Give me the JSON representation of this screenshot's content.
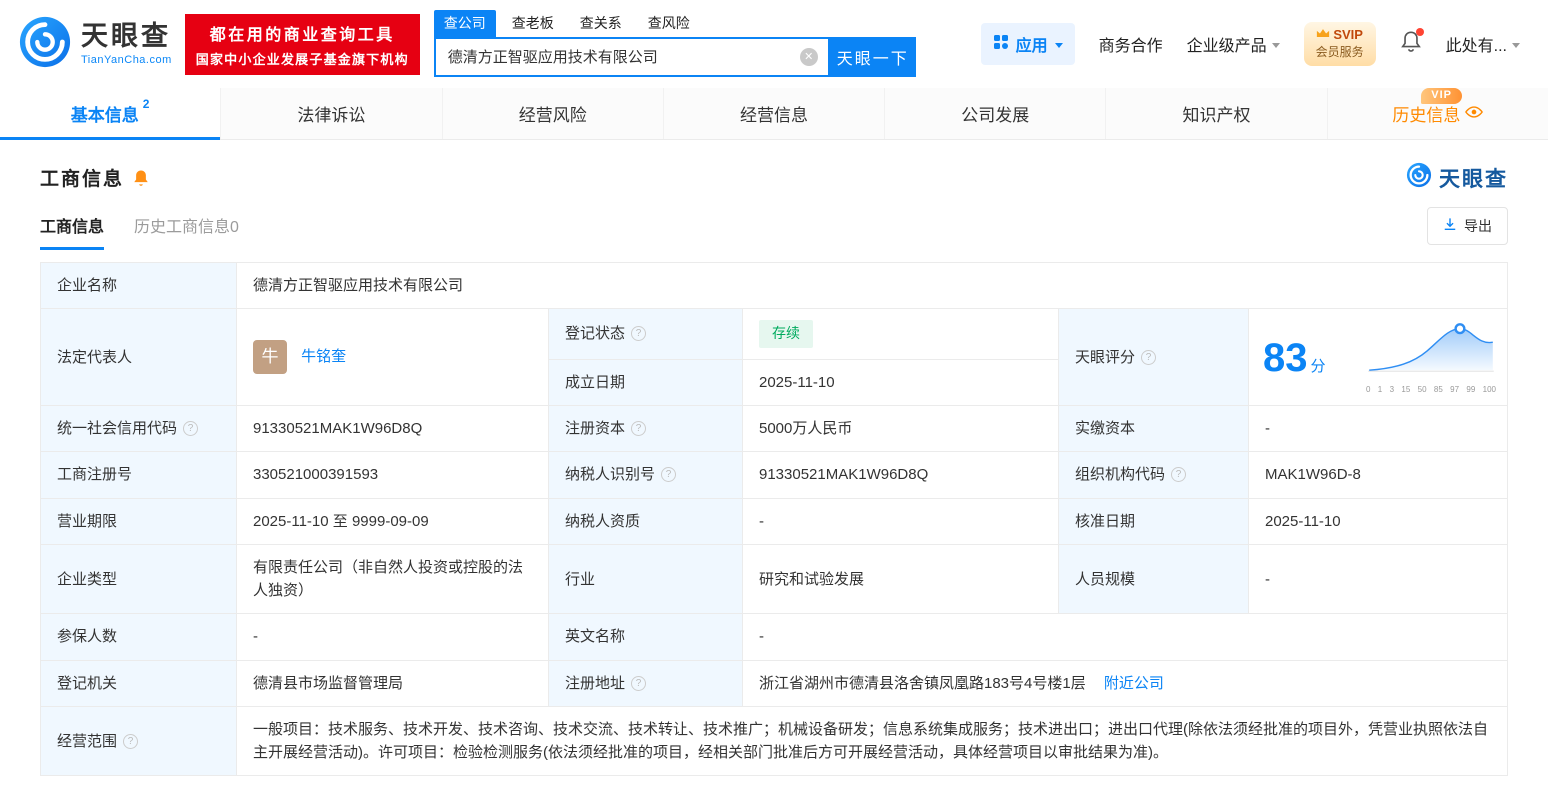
{
  "colors": {
    "accent_blue": "#0b84f5",
    "brand_red": "#e60012",
    "vip_orange": "#ff8a00",
    "status_green": "#00ab5e"
  },
  "header": {
    "logo": {
      "name_cn": "天眼查",
      "name_en": "TianYanCha.com"
    },
    "slogan_line1": "都在用的商业查询工具",
    "slogan_line2": "国家中小企业发展子基金旗下机构",
    "search_tabs": [
      {
        "label": "查公司"
      },
      {
        "label": "查老板"
      },
      {
        "label": "查关系"
      },
      {
        "label": "查风险"
      }
    ],
    "search_value": "德清方正智驱应用技术有限公司",
    "search_button": "天眼一下",
    "apps_label": "应用",
    "biz_coop": "商务合作",
    "enterprise_product": "企业级产品",
    "svip_line1": "SVIP",
    "svip_line2": "会员服务",
    "user_label": "此处有..."
  },
  "nav": {
    "tabs": [
      {
        "label": "基本信息",
        "badge": "2"
      },
      {
        "label": "法律诉讼"
      },
      {
        "label": "经营风险"
      },
      {
        "label": "经营信息"
      },
      {
        "label": "公司发展"
      },
      {
        "label": "知识产权"
      },
      {
        "label": "历史信息"
      }
    ],
    "vip_tag": "VIP"
  },
  "section": {
    "title": "工商信息",
    "watermark": "天眼查",
    "sub_tabs": [
      {
        "label": "工商信息"
      },
      {
        "label": "历史工商信息0"
      }
    ],
    "export_label": "导出"
  },
  "info": {
    "company_name": {
      "label": "企业名称",
      "value": "德清方正智驱应用技术有限公司"
    },
    "legal_rep": {
      "label": "法定代表人",
      "value": "牛铭奎",
      "avatar": "牛"
    },
    "reg_status": {
      "label": "登记状态",
      "value": "存续"
    },
    "establish_date": {
      "label": "成立日期",
      "value": "2025-11-10"
    },
    "score": {
      "label": "天眼评分",
      "value": "83",
      "unit": "分"
    },
    "credit_code": {
      "label": "统一社会信用代码",
      "value": "91330521MAK1W96D8Q"
    },
    "reg_capital": {
      "label": "注册资本",
      "value": "5000万人民币"
    },
    "paid_capital": {
      "label": "实缴资本",
      "value": "-"
    },
    "reg_number": {
      "label": "工商注册号",
      "value": "330521000391593"
    },
    "taxpayer_id": {
      "label": "纳税人识别号",
      "value": "91330521MAK1W96D8Q"
    },
    "org_code": {
      "label": "组织机构代码",
      "value": "MAK1W96D-8"
    },
    "business_term": {
      "label": "营业期限",
      "value": "2025-11-10 至 9999-09-09"
    },
    "taxpayer_quality": {
      "label": "纳税人资质",
      "value": "-"
    },
    "approval_date": {
      "label": "核准日期",
      "value": "2025-11-10"
    },
    "company_type": {
      "label": "企业类型",
      "value": "有限责任公司（非自然人投资或控股的法人独资）"
    },
    "industry": {
      "label": "行业",
      "value": "研究和试验发展"
    },
    "staff_size": {
      "label": "人员规模",
      "value": "-"
    },
    "insured_count": {
      "label": "参保人数",
      "value": "-"
    },
    "english_name": {
      "label": "英文名称",
      "value": "-"
    },
    "reg_authority": {
      "label": "登记机关",
      "value": "德清县市场监督管理局"
    },
    "reg_address": {
      "label": "注册地址",
      "value": "浙江省湖州市德清县洛舍镇凤凰路183号4号楼1层",
      "link": "附近公司"
    },
    "business_scope": {
      "label": "经营范围",
      "value": "一般项目：技术服务、技术开发、技术咨询、技术交流、技术转让、技术推广；机械设备研发；信息系统集成服务；技术进出口；进出口代理(除依法须经批准的项目外，凭营业执照依法自主开展经营活动)。许可项目：检验检测服务(依法须经批准的项目，经相关部门批准后方可开展经营活动，具体经营项目以审批结果为准)。"
    }
  },
  "score_chart": {
    "type": "area",
    "score": 83,
    "ticks": [
      "0",
      "1",
      "3",
      "15",
      "50",
      "85",
      "97",
      "99",
      "100"
    ]
  }
}
